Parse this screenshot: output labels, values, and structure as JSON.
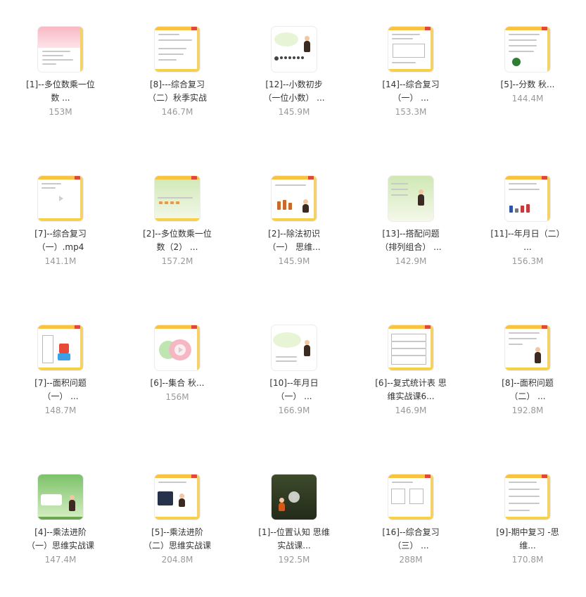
{
  "files": [
    {
      "title_1": "[1]--多位数乘一位",
      "title_2": "数 ...",
      "size": "153M",
      "thumb": "pink"
    },
    {
      "title_1": "[8]---综合复习",
      "title_2": "（二）秋季实战",
      "size": "146.7M",
      "thumb": "text"
    },
    {
      "title_1": "[12]--小数初步",
      "title_2": "（一位小数） ...",
      "size": "145.9M",
      "thumb": "teacher-dots"
    },
    {
      "title_1": "[14]--综合复习",
      "title_2": "（一） ...",
      "size": "153.3M",
      "thumb": "text-table"
    },
    {
      "title_1": "[5]--分数 秋...",
      "title_2": "",
      "size": "144.4M",
      "thumb": "watermelon"
    },
    {
      "title_1": "[7]--综合复习",
      "title_2": "（一）.mp4",
      "size": "141.1M",
      "thumb": "play"
    },
    {
      "title_1": "[2]--多位数乘一位",
      "title_2": "数（2） ...",
      "size": "157.2M",
      "thumb": "train"
    },
    {
      "title_1": "[2]--除法初识",
      "title_2": "（一） 思维...",
      "size": "145.9M",
      "thumb": "figures"
    },
    {
      "title_1": "[13]--搭配问题",
      "title_2": "（排列组合） ...",
      "size": "142.9M",
      "thumb": "teacher-green"
    },
    {
      "title_1": "[11]--年月日（二）",
      "title_2": "...",
      "size": "156.3M",
      "thumb": "calendar"
    },
    {
      "title_1": "[7]--面积问题",
      "title_2": "（一） ...",
      "size": "148.7M",
      "thumb": "tetris"
    },
    {
      "title_1": "[6]--集合 秋...",
      "title_2": "",
      "size": "156M",
      "thumb": "venn"
    },
    {
      "title_1": "[10]--年月日",
      "title_2": "（一） ...",
      "size": "166.9M",
      "thumb": "teacher-bubble"
    },
    {
      "title_1": "[6]--复式统计表 思",
      "title_2": "维实战课6...",
      "size": "146.9M",
      "thumb": "table"
    },
    {
      "title_1": "[8]--面积问题",
      "title_2": "（二） ...",
      "size": "192.8M",
      "thumb": "boy-text"
    },
    {
      "title_1": "[4]--乘法进阶",
      "title_2": "（一）思维实战课",
      "size": "147.4M",
      "thumb": "jungle"
    },
    {
      "title_1": "[5]--乘法进阶",
      "title_2": "（二）思维实战课",
      "size": "204.8M",
      "thumb": "board"
    },
    {
      "title_1": "[1]--位置认知 思维",
      "title_2": "实战课...",
      "size": "192.5M",
      "thumb": "forest"
    },
    {
      "title_1": "[16]--综合复习",
      "title_2": "（三） ...",
      "size": "288M",
      "thumb": "grid"
    },
    {
      "title_1": "[9]-期中复习 -思",
      "title_2": "维...",
      "size": "170.8M",
      "thumb": "worksheet"
    }
  ]
}
